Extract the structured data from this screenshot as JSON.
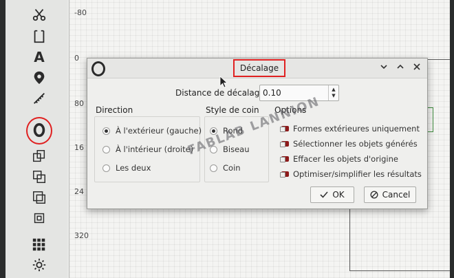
{
  "toolstrip": {
    "tools": [
      {
        "name": "cut-tool-icon"
      },
      {
        "name": "rectangle-select-tool-icon"
      },
      {
        "name": "text-tool-icon",
        "glyph": "A"
      },
      {
        "name": "location-pin-tool-icon"
      },
      {
        "name": "measure-tool-icon"
      },
      {
        "name": "offset-tool-icon"
      },
      {
        "name": "union-tool-icon"
      },
      {
        "name": "difference-tool-icon"
      },
      {
        "name": "intersection-tool-icon"
      },
      {
        "name": "xor-tool-icon"
      },
      {
        "name": "grid-tool-icon"
      },
      {
        "name": "settings-gear-icon"
      }
    ],
    "highlight_color": "#e02020"
  },
  "canvas": {
    "ruler_labels": [
      "-80",
      "0",
      "80",
      "16",
      "24",
      "320"
    ]
  },
  "watermark": "FABLAB LANNION",
  "dialog": {
    "title": "Décalage",
    "distance_label": "Distance de décalage",
    "distance_value": "0.10",
    "direction": {
      "title": "Direction",
      "options": [
        {
          "label": "À l'extérieur (gauche)",
          "checked": true
        },
        {
          "label": "À l'intérieur (droite)",
          "checked": false
        },
        {
          "label": "Les deux",
          "checked": false
        }
      ]
    },
    "corner": {
      "title": "Style de coin",
      "options": [
        {
          "label": "Rond",
          "checked": true
        },
        {
          "label": "Biseau",
          "checked": false
        },
        {
          "label": "Coin",
          "checked": false
        }
      ]
    },
    "options": {
      "title": "Options",
      "items": [
        {
          "label": "Formes extérieures uniquement",
          "checked": true
        },
        {
          "label": "Sélectionner les objets générés",
          "checked": true
        },
        {
          "label": "Effacer les objets d'origine",
          "checked": true
        },
        {
          "label": "Optimiser/simplifier les résultats",
          "checked": true
        }
      ]
    },
    "ok_label": "OK",
    "cancel_label": "Cancel"
  }
}
